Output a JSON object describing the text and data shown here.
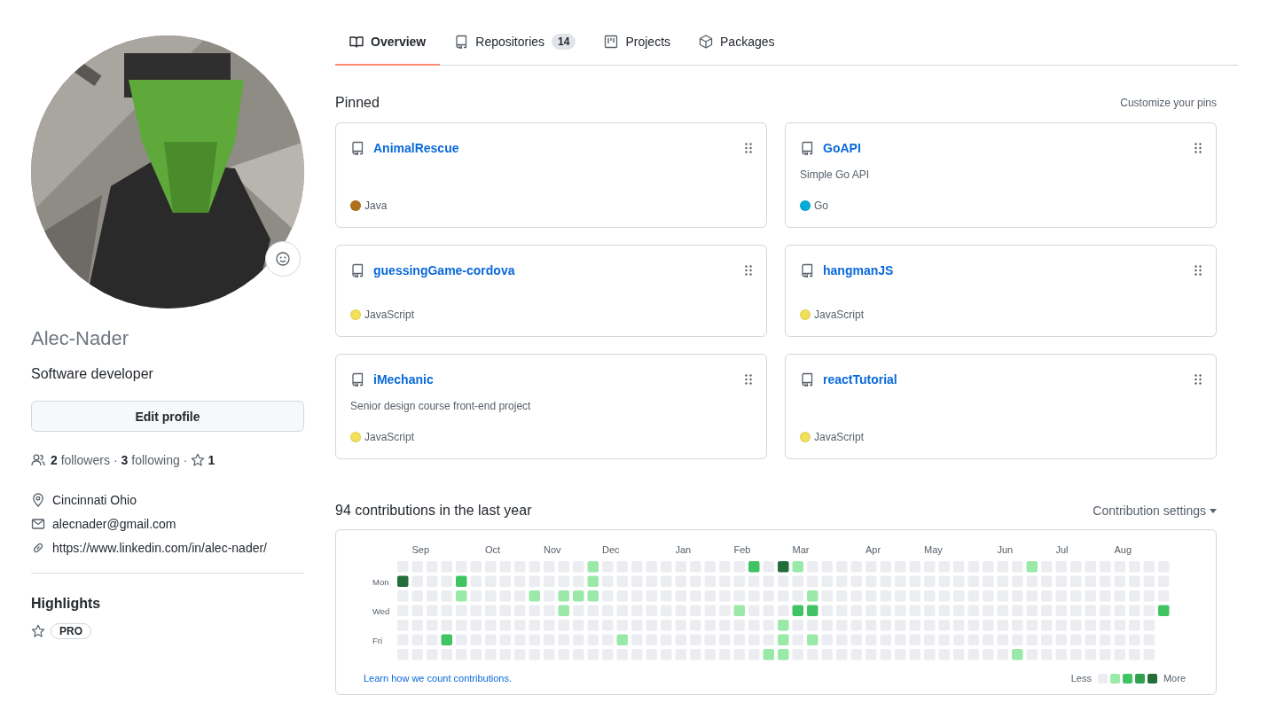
{
  "tabs": [
    {
      "label": "Overview",
      "kind": "overview",
      "selected": true
    },
    {
      "label": "Repositories",
      "kind": "repositories",
      "counter": "14",
      "selected": false
    },
    {
      "label": "Projects",
      "kind": "projects",
      "selected": false
    },
    {
      "label": "Packages",
      "kind": "packages",
      "selected": false
    }
  ],
  "profile": {
    "avatar": {
      "kind": "picture"
    },
    "username": "Alec-Nader",
    "bio": "Software developer",
    "edit_button": "Edit profile",
    "followers": {
      "count": "2",
      "label": "followers"
    },
    "following": {
      "count": "3",
      "label": "following"
    },
    "stars": {
      "count": "1"
    },
    "separators": [
      "·",
      "·"
    ],
    "details": [
      {
        "kind": "location",
        "text": "Cincinnati Ohio"
      },
      {
        "kind": "email",
        "text": "alecnader@gmail.com"
      },
      {
        "kind": "website",
        "text": "https://www.linkedin.com/in/alec-nader/"
      }
    ],
    "highlights": {
      "title": "Highlights",
      "badge": "PRO"
    }
  },
  "pinned": {
    "title": "Pinned",
    "customize": "Customize your pins",
    "repos": [
      {
        "name": "AnimalRescue",
        "language": "Java",
        "color": "#b07219"
      },
      {
        "name": "GoAPI",
        "description": "Simple Go API",
        "language": "Go",
        "color": "#00add8"
      },
      {
        "name": "guessingGame-cordova",
        "language": "JavaScript",
        "color": "#f1e05a"
      },
      {
        "name": "hangmanJS",
        "language": "JavaScript",
        "color": "#f1e05a"
      },
      {
        "name": "iMechanic",
        "description": "Senior design course front-end project",
        "language": "JavaScript",
        "color": "#f1e05a"
      },
      {
        "name": "reactTutorial",
        "language": "JavaScript",
        "color": "#f1e05a"
      }
    ]
  },
  "contributions": {
    "title": "94 contributions in the last year",
    "settings": "Contribution settings",
    "day_labels": [
      "Mon",
      "Wed",
      "Fri"
    ],
    "weeks": [
      {
        "days": [
          {
            "color": "#ebedf0"
          },
          {
            "color": "#216e39"
          },
          {
            "color": "#ebedf0"
          },
          {
            "color": "#ebedf0"
          },
          {
            "color": "#ebedf0"
          },
          {
            "color": "#ebedf0"
          },
          {
            "color": "#ebedf0"
          }
        ]
      },
      {
        "month": "Sep",
        "days": [
          {
            "color": "#ebedf0"
          },
          {
            "color": "#ebedf0"
          },
          {
            "color": "#ebedf0"
          },
          {
            "color": "#ebedf0"
          },
          {
            "color": "#ebedf0"
          },
          {
            "color": "#ebedf0"
          },
          {
            "color": "#ebedf0"
          }
        ]
      },
      {
        "days": [
          {
            "color": "#ebedf0"
          },
          {
            "color": "#ebedf0"
          },
          {
            "color": "#ebedf0"
          },
          {
            "color": "#ebedf0"
          },
          {
            "color": "#ebedf0"
          },
          {
            "color": "#ebedf0"
          },
          {
            "color": "#ebedf0"
          }
        ]
      },
      {
        "days": [
          {
            "color": "#ebedf0"
          },
          {
            "color": "#ebedf0"
          },
          {
            "color": "#ebedf0"
          },
          {
            "color": "#ebedf0"
          },
          {
            "color": "#ebedf0"
          },
          {
            "color": "#40c463"
          },
          {
            "color": "#ebedf0"
          }
        ]
      },
      {
        "days": [
          {
            "color": "#ebedf0"
          },
          {
            "color": "#40c463"
          },
          {
            "color": "#9be9a8"
          },
          {
            "color": "#ebedf0"
          },
          {
            "color": "#ebedf0"
          },
          {
            "color": "#ebedf0"
          },
          {
            "color": "#ebedf0"
          }
        ]
      },
      {
        "days": [
          {
            "color": "#ebedf0"
          },
          {
            "color": "#ebedf0"
          },
          {
            "color": "#ebedf0"
          },
          {
            "color": "#ebedf0"
          },
          {
            "color": "#ebedf0"
          },
          {
            "color": "#ebedf0"
          },
          {
            "color": "#ebedf0"
          }
        ]
      },
      {
        "month": "Oct",
        "days": [
          {
            "color": "#ebedf0"
          },
          {
            "color": "#ebedf0"
          },
          {
            "color": "#ebedf0"
          },
          {
            "color": "#ebedf0"
          },
          {
            "color": "#ebedf0"
          },
          {
            "color": "#ebedf0"
          },
          {
            "color": "#ebedf0"
          }
        ]
      },
      {
        "days": [
          {
            "color": "#ebedf0"
          },
          {
            "color": "#ebedf0"
          },
          {
            "color": "#ebedf0"
          },
          {
            "color": "#ebedf0"
          },
          {
            "color": "#ebedf0"
          },
          {
            "color": "#ebedf0"
          },
          {
            "color": "#ebedf0"
          }
        ]
      },
      {
        "days": [
          {
            "color": "#ebedf0"
          },
          {
            "color": "#ebedf0"
          },
          {
            "color": "#ebedf0"
          },
          {
            "color": "#ebedf0"
          },
          {
            "color": "#ebedf0"
          },
          {
            "color": "#ebedf0"
          },
          {
            "color": "#ebedf0"
          }
        ]
      },
      {
        "days": [
          {
            "color": "#ebedf0"
          },
          {
            "color": "#ebedf0"
          },
          {
            "color": "#9be9a8"
          },
          {
            "color": "#ebedf0"
          },
          {
            "color": "#ebedf0"
          },
          {
            "color": "#ebedf0"
          },
          {
            "color": "#ebedf0"
          }
        ]
      },
      {
        "month": "Nov",
        "days": [
          {
            "color": "#ebedf0"
          },
          {
            "color": "#ebedf0"
          },
          {
            "color": "#ebedf0"
          },
          {
            "color": "#ebedf0"
          },
          {
            "color": "#ebedf0"
          },
          {
            "color": "#ebedf0"
          },
          {
            "color": "#ebedf0"
          }
        ]
      },
      {
        "days": [
          {
            "color": "#ebedf0"
          },
          {
            "color": "#ebedf0"
          },
          {
            "color": "#9be9a8"
          },
          {
            "color": "#9be9a8"
          },
          {
            "color": "#ebedf0"
          },
          {
            "color": "#ebedf0"
          },
          {
            "color": "#ebedf0"
          }
        ]
      },
      {
        "days": [
          {
            "color": "#ebedf0"
          },
          {
            "color": "#ebedf0"
          },
          {
            "color": "#9be9a8"
          },
          {
            "color": "#ebedf0"
          },
          {
            "color": "#ebedf0"
          },
          {
            "color": "#ebedf0"
          },
          {
            "color": "#ebedf0"
          }
        ]
      },
      {
        "days": [
          {
            "color": "#9be9a8"
          },
          {
            "color": "#9be9a8"
          },
          {
            "color": "#9be9a8"
          },
          {
            "color": "#ebedf0"
          },
          {
            "color": "#ebedf0"
          },
          {
            "color": "#ebedf0"
          },
          {
            "color": "#ebedf0"
          }
        ]
      },
      {
        "month": "Dec",
        "days": [
          {
            "color": "#ebedf0"
          },
          {
            "color": "#ebedf0"
          },
          {
            "color": "#ebedf0"
          },
          {
            "color": "#ebedf0"
          },
          {
            "color": "#ebedf0"
          },
          {
            "color": "#ebedf0"
          },
          {
            "color": "#ebedf0"
          }
        ]
      },
      {
        "days": [
          {
            "color": "#ebedf0"
          },
          {
            "color": "#ebedf0"
          },
          {
            "color": "#ebedf0"
          },
          {
            "color": "#ebedf0"
          },
          {
            "color": "#ebedf0"
          },
          {
            "color": "#9be9a8"
          },
          {
            "color": "#ebedf0"
          }
        ]
      },
      {
        "days": [
          {
            "color": "#ebedf0"
          },
          {
            "color": "#ebedf0"
          },
          {
            "color": "#ebedf0"
          },
          {
            "color": "#ebedf0"
          },
          {
            "color": "#ebedf0"
          },
          {
            "color": "#ebedf0"
          },
          {
            "color": "#ebedf0"
          }
        ]
      },
      {
        "days": [
          {
            "color": "#ebedf0"
          },
          {
            "color": "#ebedf0"
          },
          {
            "color": "#ebedf0"
          },
          {
            "color": "#ebedf0"
          },
          {
            "color": "#ebedf0"
          },
          {
            "color": "#ebedf0"
          },
          {
            "color": "#ebedf0"
          }
        ]
      },
      {
        "days": [
          {
            "color": "#ebedf0"
          },
          {
            "color": "#ebedf0"
          },
          {
            "color": "#ebedf0"
          },
          {
            "color": "#ebedf0"
          },
          {
            "color": "#ebedf0"
          },
          {
            "color": "#ebedf0"
          },
          {
            "color": "#ebedf0"
          }
        ]
      },
      {
        "month": "Jan",
        "days": [
          {
            "color": "#ebedf0"
          },
          {
            "color": "#ebedf0"
          },
          {
            "color": "#ebedf0"
          },
          {
            "color": "#ebedf0"
          },
          {
            "color": "#ebedf0"
          },
          {
            "color": "#ebedf0"
          },
          {
            "color": "#ebedf0"
          }
        ]
      },
      {
        "days": [
          {
            "color": "#ebedf0"
          },
          {
            "color": "#ebedf0"
          },
          {
            "color": "#ebedf0"
          },
          {
            "color": "#ebedf0"
          },
          {
            "color": "#ebedf0"
          },
          {
            "color": "#ebedf0"
          },
          {
            "color": "#ebedf0"
          }
        ]
      },
      {
        "days": [
          {
            "color": "#ebedf0"
          },
          {
            "color": "#ebedf0"
          },
          {
            "color": "#ebedf0"
          },
          {
            "color": "#ebedf0"
          },
          {
            "color": "#ebedf0"
          },
          {
            "color": "#ebedf0"
          },
          {
            "color": "#ebedf0"
          }
        ]
      },
      {
        "days": [
          {
            "color": "#ebedf0"
          },
          {
            "color": "#ebedf0"
          },
          {
            "color": "#ebedf0"
          },
          {
            "color": "#ebedf0"
          },
          {
            "color": "#ebedf0"
          },
          {
            "color": "#ebedf0"
          },
          {
            "color": "#ebedf0"
          }
        ]
      },
      {
        "month": "Feb",
        "days": [
          {
            "color": "#ebedf0"
          },
          {
            "color": "#ebedf0"
          },
          {
            "color": "#ebedf0"
          },
          {
            "color": "#9be9a8"
          },
          {
            "color": "#ebedf0"
          },
          {
            "color": "#ebedf0"
          },
          {
            "color": "#ebedf0"
          }
        ]
      },
      {
        "days": [
          {
            "color": "#40c463"
          },
          {
            "color": "#ebedf0"
          },
          {
            "color": "#ebedf0"
          },
          {
            "color": "#ebedf0"
          },
          {
            "color": "#ebedf0"
          },
          {
            "color": "#ebedf0"
          },
          {
            "color": "#ebedf0"
          }
        ]
      },
      {
        "days": [
          {
            "color": "#ebedf0"
          },
          {
            "color": "#ebedf0"
          },
          {
            "color": "#ebedf0"
          },
          {
            "color": "#ebedf0"
          },
          {
            "color": "#ebedf0"
          },
          {
            "color": "#ebedf0"
          },
          {
            "color": "#9be9a8"
          }
        ]
      },
      {
        "days": [
          {
            "color": "#216e39"
          },
          {
            "color": "#ebedf0"
          },
          {
            "color": "#ebedf0"
          },
          {
            "color": "#ebedf0"
          },
          {
            "color": "#9be9a8"
          },
          {
            "color": "#9be9a8"
          },
          {
            "color": "#9be9a8"
          }
        ]
      },
      {
        "month": "Mar",
        "days": [
          {
            "color": "#9be9a8"
          },
          {
            "color": "#ebedf0"
          },
          {
            "color": "#ebedf0"
          },
          {
            "color": "#40c463"
          },
          {
            "color": "#ebedf0"
          },
          {
            "color": "#ebedf0"
          },
          {
            "color": "#ebedf0"
          }
        ]
      },
      {
        "days": [
          {
            "color": "#ebedf0"
          },
          {
            "color": "#ebedf0"
          },
          {
            "color": "#9be9a8"
          },
          {
            "color": "#40c463"
          },
          {
            "color": "#ebedf0"
          },
          {
            "color": "#9be9a8"
          },
          {
            "color": "#ebedf0"
          }
        ]
      },
      {
        "days": [
          {
            "color": "#ebedf0"
          },
          {
            "color": "#ebedf0"
          },
          {
            "color": "#ebedf0"
          },
          {
            "color": "#ebedf0"
          },
          {
            "color": "#ebedf0"
          },
          {
            "color": "#ebedf0"
          },
          {
            "color": "#ebedf0"
          }
        ]
      },
      {
        "days": [
          {
            "color": "#ebedf0"
          },
          {
            "color": "#ebedf0"
          },
          {
            "color": "#ebedf0"
          },
          {
            "color": "#ebedf0"
          },
          {
            "color": "#ebedf0"
          },
          {
            "color": "#ebedf0"
          },
          {
            "color": "#ebedf0"
          }
        ]
      },
      {
        "days": [
          {
            "color": "#ebedf0"
          },
          {
            "color": "#ebedf0"
          },
          {
            "color": "#ebedf0"
          },
          {
            "color": "#ebedf0"
          },
          {
            "color": "#ebedf0"
          },
          {
            "color": "#ebedf0"
          },
          {
            "color": "#ebedf0"
          }
        ]
      },
      {
        "month": "Apr",
        "days": [
          {
            "color": "#ebedf0"
          },
          {
            "color": "#ebedf0"
          },
          {
            "color": "#ebedf0"
          },
          {
            "color": "#ebedf0"
          },
          {
            "color": "#ebedf0"
          },
          {
            "color": "#ebedf0"
          },
          {
            "color": "#ebedf0"
          }
        ]
      },
      {
        "days": [
          {
            "color": "#ebedf0"
          },
          {
            "color": "#ebedf0"
          },
          {
            "color": "#ebedf0"
          },
          {
            "color": "#ebedf0"
          },
          {
            "color": "#ebedf0"
          },
          {
            "color": "#ebedf0"
          },
          {
            "color": "#ebedf0"
          }
        ]
      },
      {
        "days": [
          {
            "color": "#ebedf0"
          },
          {
            "color": "#ebedf0"
          },
          {
            "color": "#ebedf0"
          },
          {
            "color": "#ebedf0"
          },
          {
            "color": "#ebedf0"
          },
          {
            "color": "#ebedf0"
          },
          {
            "color": "#ebedf0"
          }
        ]
      },
      {
        "days": [
          {
            "color": "#ebedf0"
          },
          {
            "color": "#ebedf0"
          },
          {
            "color": "#ebedf0"
          },
          {
            "color": "#ebedf0"
          },
          {
            "color": "#ebedf0"
          },
          {
            "color": "#ebedf0"
          },
          {
            "color": "#ebedf0"
          }
        ]
      },
      {
        "month": "May",
        "days": [
          {
            "color": "#ebedf0"
          },
          {
            "color": "#ebedf0"
          },
          {
            "color": "#ebedf0"
          },
          {
            "color": "#ebedf0"
          },
          {
            "color": "#ebedf0"
          },
          {
            "color": "#ebedf0"
          },
          {
            "color": "#ebedf0"
          }
        ]
      },
      {
        "days": [
          {
            "color": "#ebedf0"
          },
          {
            "color": "#ebedf0"
          },
          {
            "color": "#ebedf0"
          },
          {
            "color": "#ebedf0"
          },
          {
            "color": "#ebedf0"
          },
          {
            "color": "#ebedf0"
          },
          {
            "color": "#ebedf0"
          }
        ]
      },
      {
        "days": [
          {
            "color": "#ebedf0"
          },
          {
            "color": "#ebedf0"
          },
          {
            "color": "#ebedf0"
          },
          {
            "color": "#ebedf0"
          },
          {
            "color": "#ebedf0"
          },
          {
            "color": "#ebedf0"
          },
          {
            "color": "#ebedf0"
          }
        ]
      },
      {
        "days": [
          {
            "color": "#ebedf0"
          },
          {
            "color": "#ebedf0"
          },
          {
            "color": "#ebedf0"
          },
          {
            "color": "#ebedf0"
          },
          {
            "color": "#ebedf0"
          },
          {
            "color": "#ebedf0"
          },
          {
            "color": "#ebedf0"
          }
        ]
      },
      {
        "days": [
          {
            "color": "#ebedf0"
          },
          {
            "color": "#ebedf0"
          },
          {
            "color": "#ebedf0"
          },
          {
            "color": "#ebedf0"
          },
          {
            "color": "#ebedf0"
          },
          {
            "color": "#ebedf0"
          },
          {
            "color": "#ebedf0"
          }
        ]
      },
      {
        "month": "Jun",
        "days": [
          {
            "color": "#ebedf0"
          },
          {
            "color": "#ebedf0"
          },
          {
            "color": "#ebedf0"
          },
          {
            "color": "#ebedf0"
          },
          {
            "color": "#ebedf0"
          },
          {
            "color": "#ebedf0"
          },
          {
            "color": "#ebedf0"
          }
        ]
      },
      {
        "days": [
          {
            "color": "#ebedf0"
          },
          {
            "color": "#ebedf0"
          },
          {
            "color": "#ebedf0"
          },
          {
            "color": "#ebedf0"
          },
          {
            "color": "#ebedf0"
          },
          {
            "color": "#ebedf0"
          },
          {
            "color": "#9be9a8"
          }
        ]
      },
      {
        "days": [
          {
            "color": "#9be9a8"
          },
          {
            "color": "#ebedf0"
          },
          {
            "color": "#ebedf0"
          },
          {
            "color": "#ebedf0"
          },
          {
            "color": "#ebedf0"
          },
          {
            "color": "#ebedf0"
          },
          {
            "color": "#ebedf0"
          }
        ]
      },
      {
        "days": [
          {
            "color": "#ebedf0"
          },
          {
            "color": "#ebedf0"
          },
          {
            "color": "#ebedf0"
          },
          {
            "color": "#ebedf0"
          },
          {
            "color": "#ebedf0"
          },
          {
            "color": "#ebedf0"
          },
          {
            "color": "#ebedf0"
          }
        ]
      },
      {
        "month": "Jul",
        "days": [
          {
            "color": "#ebedf0"
          },
          {
            "color": "#ebedf0"
          },
          {
            "color": "#ebedf0"
          },
          {
            "color": "#ebedf0"
          },
          {
            "color": "#ebedf0"
          },
          {
            "color": "#ebedf0"
          },
          {
            "color": "#ebedf0"
          }
        ]
      },
      {
        "days": [
          {
            "color": "#ebedf0"
          },
          {
            "color": "#ebedf0"
          },
          {
            "color": "#ebedf0"
          },
          {
            "color": "#ebedf0"
          },
          {
            "color": "#ebedf0"
          },
          {
            "color": "#ebedf0"
          },
          {
            "color": "#ebedf0"
          }
        ]
      },
      {
        "days": [
          {
            "color": "#ebedf0"
          },
          {
            "color": "#ebedf0"
          },
          {
            "color": "#ebedf0"
          },
          {
            "color": "#ebedf0"
          },
          {
            "color": "#ebedf0"
          },
          {
            "color": "#ebedf0"
          },
          {
            "color": "#ebedf0"
          }
        ]
      },
      {
        "days": [
          {
            "color": "#ebedf0"
          },
          {
            "color": "#ebedf0"
          },
          {
            "color": "#ebedf0"
          },
          {
            "color": "#ebedf0"
          },
          {
            "color": "#ebedf0"
          },
          {
            "color": "#ebedf0"
          },
          {
            "color": "#ebedf0"
          }
        ]
      },
      {
        "month": "Aug",
        "days": [
          {
            "color": "#ebedf0"
          },
          {
            "color": "#ebedf0"
          },
          {
            "color": "#ebedf0"
          },
          {
            "color": "#ebedf0"
          },
          {
            "color": "#ebedf0"
          },
          {
            "color": "#ebedf0"
          },
          {
            "color": "#ebedf0"
          }
        ]
      },
      {
        "days": [
          {
            "color": "#ebedf0"
          },
          {
            "color": "#ebedf0"
          },
          {
            "color": "#ebedf0"
          },
          {
            "color": "#ebedf0"
          },
          {
            "color": "#ebedf0"
          },
          {
            "color": "#ebedf0"
          },
          {
            "color": "#ebedf0"
          }
        ]
      },
      {
        "days": [
          {
            "color": "#ebedf0"
          },
          {
            "color": "#ebedf0"
          },
          {
            "color": "#ebedf0"
          },
          {
            "color": "#ebedf0"
          },
          {
            "color": "#ebedf0"
          },
          {
            "color": "#ebedf0"
          },
          {
            "color": "#ebedf0"
          }
        ]
      },
      {
        "days": [
          {
            "color": "#ebedf0"
          },
          {
            "color": "#ebedf0"
          },
          {
            "color": "#ebedf0"
          },
          {
            "color": "#40c463"
          }
        ]
      }
    ],
    "learn_link": "Learn how we count contributions.",
    "legend": {
      "less": "Less",
      "more": "More",
      "swatches": [
        {
          "color": "#ebedf0"
        },
        {
          "color": "#9be9a8"
        },
        {
          "color": "#40c463"
        },
        {
          "color": "#30a14e"
        },
        {
          "color": "#216e39"
        }
      ]
    }
  }
}
